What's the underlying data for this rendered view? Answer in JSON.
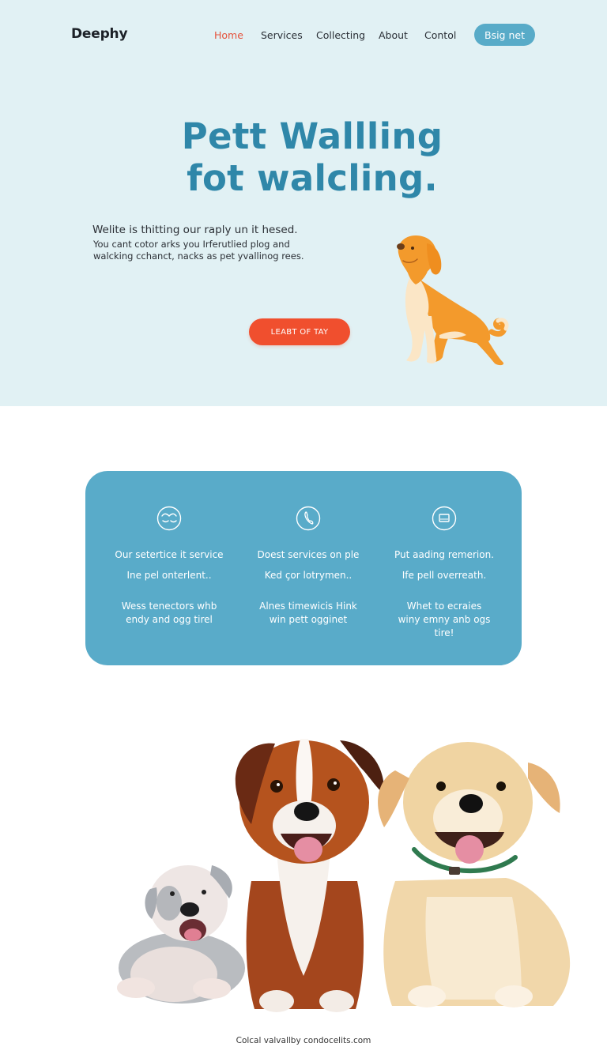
{
  "brand": {
    "name": "Deephy"
  },
  "nav": {
    "items": [
      {
        "label": "Home",
        "active": true
      },
      {
        "label": "Services",
        "active": false
      },
      {
        "label": "Collecting",
        "active": false
      },
      {
        "label": "About",
        "active": false
      },
      {
        "label": "Contol",
        "active": false
      }
    ],
    "cta_label": "Bsig net"
  },
  "hero": {
    "title_line1": "Pett Wallling",
    "title_line2": "fot walcling.",
    "lead": "Welite is thitting our raply un it hesed.",
    "body": "You cant cotor arks you Irferutlied plog and walcking cchanct, nacks as pet yvallinog rees.",
    "cta_label": "LEABT OF TAY",
    "illustration": "orange-dog-illustration"
  },
  "features": [
    {
      "icon": "heart-waves-icon",
      "title": "Our setertice it service",
      "subtitle": "Ine pel onterlent..",
      "description": "Wess tenectors whb endy and ogg tirel"
    },
    {
      "icon": "phone-icon",
      "title": "Doest services on ple",
      "subtitle": "Ked çor lotrymen..",
      "description": "Alnes timewicis Hink win pett ogginet"
    },
    {
      "icon": "tablet-icon",
      "title": "Put aading remerion.",
      "subtitle": "Ife pell overreath.",
      "description": "Whet to ecraies winy emny anb ogs tire!"
    }
  ],
  "photo": {
    "subject": "three-puppies-photo"
  },
  "footer": {
    "text": "Colcal valvallby condocelits.com"
  },
  "colors": {
    "hero_bg": "#e1f1f4",
    "accent_blue": "#2f87a9",
    "card_blue": "#59abc9",
    "nav_button": "#58abc8",
    "cta_orange": "#f04f2e",
    "nav_active": "#e5533c"
  }
}
